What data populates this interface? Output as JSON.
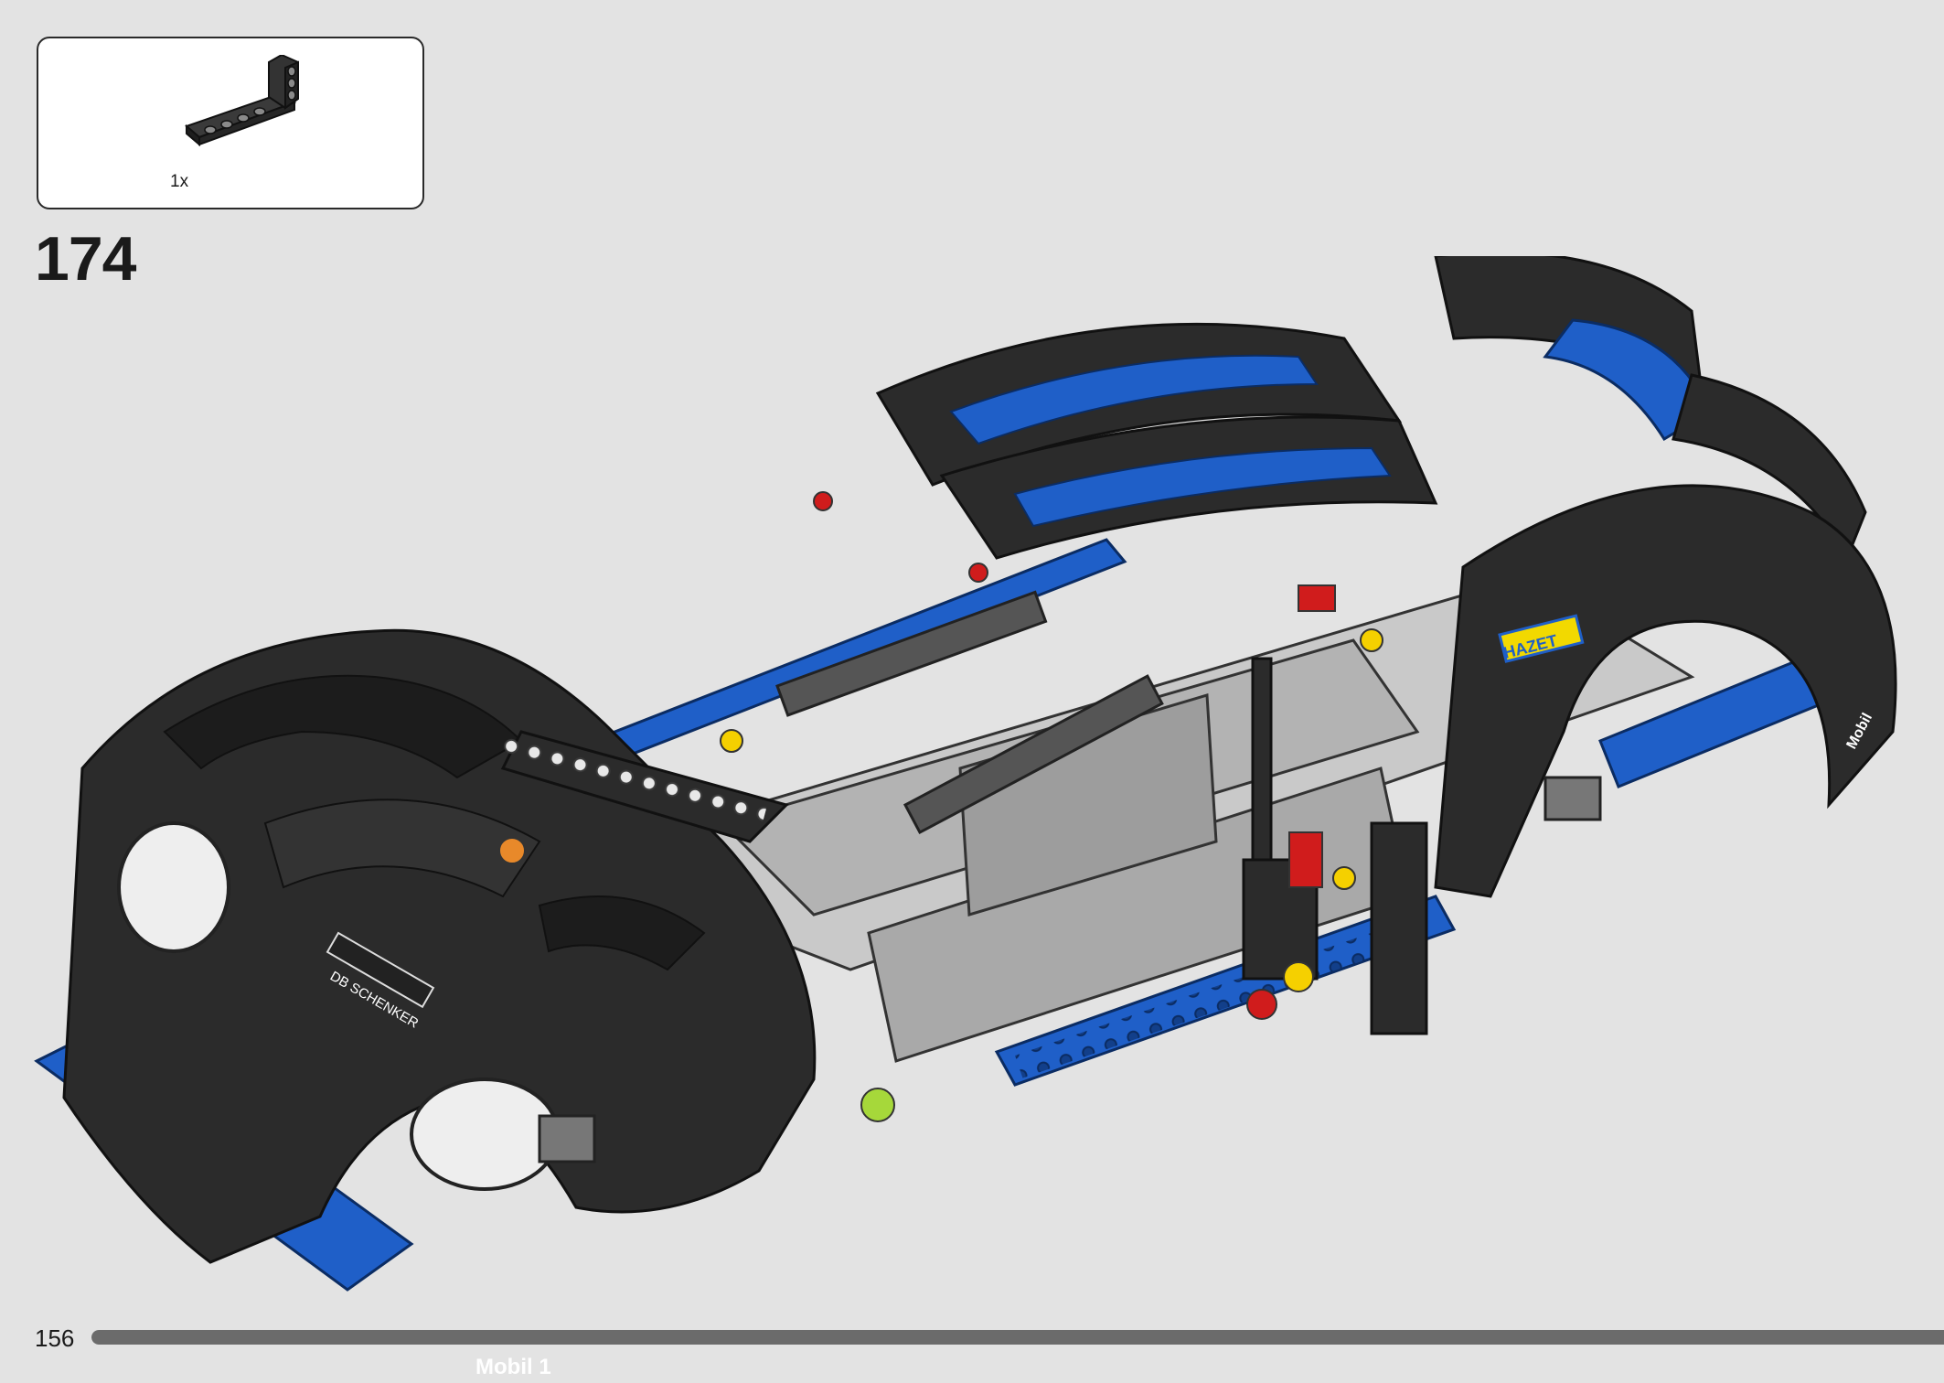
{
  "parts_callout": {
    "quantity_label": "1x",
    "part_icon": "technic-l-beam-black"
  },
  "step": {
    "number": "174"
  },
  "decals": {
    "db_schenker": "DB SCHENKER",
    "hazet": "HAZET",
    "mobil_front": "Mobil 1",
    "mobil_side": "Mobil"
  },
  "footer": {
    "page_number": "156",
    "progress_fraction": 1.0
  },
  "colors": {
    "background": "#e3e3e3",
    "body_black": "#2b2b2b",
    "technic_blue": "#1f5fc8",
    "light_grey": "#bdbdbd",
    "accent_red": "#d01c1c",
    "accent_yellow": "#f5d000",
    "accent_orange": "#e8892a",
    "accent_lime": "#a6d83a"
  }
}
